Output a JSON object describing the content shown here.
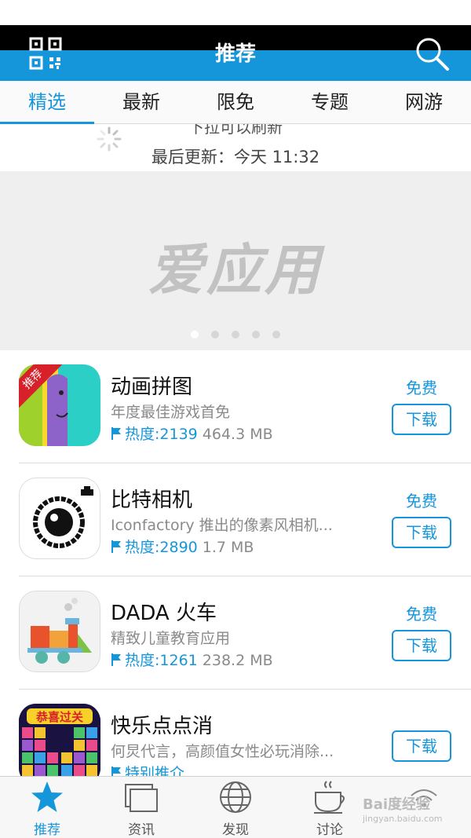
{
  "header": {
    "title": "推荐",
    "qr_icon": "qr-scan-icon",
    "search_icon": "search-icon"
  },
  "tabs": [
    {
      "label": "精选",
      "active": true
    },
    {
      "label": "最新"
    },
    {
      "label": "限免"
    },
    {
      "label": "专题"
    },
    {
      "label": "网游"
    }
  ],
  "refresh": {
    "pull_text": "下拉可以刷新",
    "updated": "最后更新：今天 11:32"
  },
  "banner": {
    "logo_text": "爱应用",
    "dots": 5,
    "active_dot": 0
  },
  "apps": [
    {
      "name": "动画拼图",
      "desc": "年度最佳游戏首免",
      "heat": "热度:2139",
      "size": "464.3 MB",
      "price": "免费",
      "button": "下载",
      "badge": "推荐"
    },
    {
      "name": "比特相机",
      "desc": "Iconfactory 推出的像素风相机...",
      "heat": "热度:2890",
      "size": "1.7 MB",
      "price": "免费",
      "button": "下载"
    },
    {
      "name": "DADA 火车",
      "desc": "精致儿童教育应用",
      "heat": "热度:1261",
      "size": "238.2 MB",
      "price": "免费",
      "button": "下载"
    },
    {
      "name": "快乐点点消",
      "desc": "何炅代言，高颜值女性必玩消除...",
      "heat": "特别推介",
      "size": "",
      "price": "",
      "button": "下载",
      "icon_text": "恭喜过关"
    }
  ],
  "bottom_nav": [
    {
      "label": "推荐",
      "icon": "star-icon",
      "active": true
    },
    {
      "label": "资讯",
      "icon": "news-icon"
    },
    {
      "label": "发现",
      "icon": "globe-icon"
    },
    {
      "label": "讨论",
      "icon": "coffee-icon"
    },
    {
      "label": "",
      "icon": "wifi-icon"
    }
  ],
  "watermark": {
    "text": "Bai度经验",
    "sub": "jingyan.baidu.com"
  },
  "colors": {
    "accent": "#1596db",
    "badge": "#d8202b"
  }
}
